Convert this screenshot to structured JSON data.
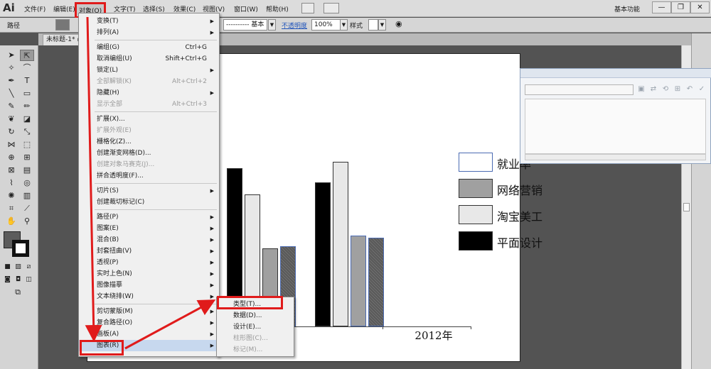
{
  "app": {
    "logo": "Ai",
    "workspace": "基本功能",
    "window_buttons": [
      "—",
      "❐",
      "✕"
    ]
  },
  "menubar": {
    "items": [
      "文件(F)",
      "编辑(E)",
      "对象(O)",
      "文字(T)",
      "选择(S)",
      "效果(C)",
      "视图(V)",
      "窗口(W)",
      "帮助(H)"
    ]
  },
  "controlbar": {
    "path_label": "路径",
    "stroke_style": "基本",
    "opacity_label": "不透明度",
    "opacity_value": "100%",
    "style_label": "样式"
  },
  "document": {
    "tab": "未标题-1* @"
  },
  "object_menu": {
    "items": [
      {
        "label": "变换(T)",
        "submenu": true
      },
      {
        "label": "排列(A)",
        "submenu": true
      },
      {
        "label": "编组(G)",
        "shortcut": "Ctrl+G"
      },
      {
        "label": "取消编组(U)",
        "shortcut": "Shift+Ctrl+G"
      },
      {
        "label": "锁定(L)",
        "submenu": true
      },
      {
        "label": "全部解锁(K)",
        "shortcut": "Alt+Ctrl+2",
        "disabled": true
      },
      {
        "label": "隐藏(H)",
        "submenu": true
      },
      {
        "label": "显示全部",
        "shortcut": "Alt+Ctrl+3",
        "disabled": true
      },
      {
        "label": "扩展(X)..."
      },
      {
        "label": "扩展外观(E)",
        "disabled": true
      },
      {
        "label": "栅格化(Z)..."
      },
      {
        "label": "创建渐变网格(D)..."
      },
      {
        "label": "创建对象马赛克(J)...",
        "disabled": true
      },
      {
        "label": "拼合透明度(F)..."
      },
      {
        "label": "切片(S)",
        "submenu": true
      },
      {
        "label": "创建裁切标记(C)"
      },
      {
        "label": "路径(P)",
        "submenu": true
      },
      {
        "label": "图案(E)",
        "submenu": true
      },
      {
        "label": "混合(B)",
        "submenu": true
      },
      {
        "label": "封套扭曲(V)",
        "submenu": true
      },
      {
        "label": "透视(P)",
        "submenu": true
      },
      {
        "label": "实时上色(N)",
        "submenu": true
      },
      {
        "label": "图像描摹",
        "submenu": true
      },
      {
        "label": "文本绕排(W)",
        "submenu": true
      },
      {
        "label": "剪切蒙版(M)",
        "submenu": true
      },
      {
        "label": "复合路径(O)",
        "submenu": true
      },
      {
        "label": "画板(A)",
        "submenu": true
      },
      {
        "label": "图表(R)",
        "submenu": true,
        "highlighted": true
      }
    ]
  },
  "graph_submenu": {
    "items": [
      {
        "label": "类型(T)..."
      },
      {
        "label": "数据(D)..."
      },
      {
        "label": "设计(E)..."
      },
      {
        "label": "柱形图(C)...",
        "disabled": true
      },
      {
        "label": "标记(M)...",
        "disabled": true
      }
    ]
  },
  "chart_data": {
    "type": "bar",
    "categories": [
      "",
      "2012年"
    ],
    "series": [
      {
        "name": "平面设计",
        "values": [
          77,
          70
        ],
        "color": "#000000"
      },
      {
        "name": "淘宝美工",
        "values": [
          64,
          80
        ],
        "color": "#e8e8e8"
      },
      {
        "name": "网络营销",
        "values": [
          38,
          44
        ],
        "color": "#a0a0a0"
      },
      {
        "name": "就业率",
        "values": [
          39,
          43
        ],
        "color": "#5a5a5a",
        "pattern": "hatched"
      }
    ],
    "legend_order": [
      "就业率",
      "网络营销",
      "淘宝美工",
      "平面设计"
    ],
    "legend": "right",
    "ylim": [
      0,
      100
    ],
    "grid": false
  },
  "colors": {
    "highlight_annotation": "#e01b1b",
    "menu_hover": "#c7d8ee"
  }
}
